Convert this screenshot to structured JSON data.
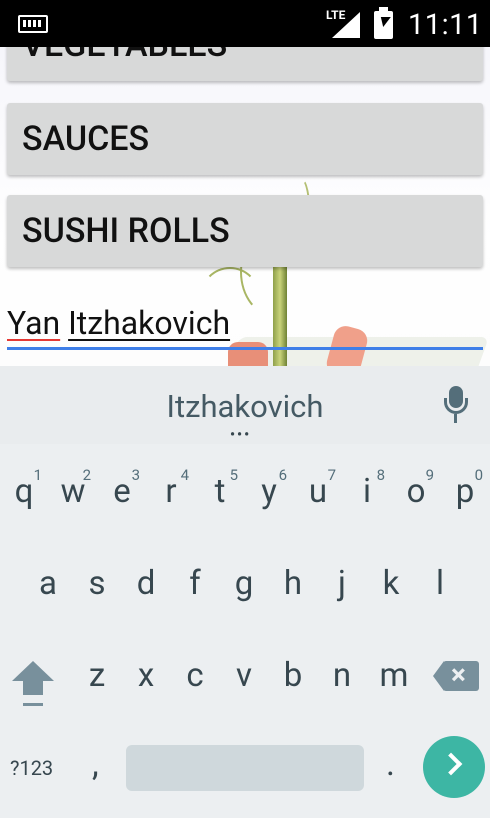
{
  "status_bar": {
    "network_label": "LTE",
    "time": "11:11"
  },
  "app": {
    "categories": [
      "VEGETABLES",
      "SAUCES",
      "SUSHI ROLLS"
    ],
    "input": {
      "word1": "Yan",
      "word2": "Itzhakovich"
    }
  },
  "keyboard": {
    "suggestion": "Itzhakovich",
    "suggestion_more": "•••",
    "row1": [
      {
        "key": "q",
        "num": "1"
      },
      {
        "key": "w",
        "num": "2"
      },
      {
        "key": "e",
        "num": "3"
      },
      {
        "key": "r",
        "num": "4"
      },
      {
        "key": "t",
        "num": "5"
      },
      {
        "key": "y",
        "num": "6"
      },
      {
        "key": "u",
        "num": "7"
      },
      {
        "key": "i",
        "num": "8"
      },
      {
        "key": "o",
        "num": "9"
      },
      {
        "key": "p",
        "num": "0"
      }
    ],
    "row2": [
      "a",
      "s",
      "d",
      "f",
      "g",
      "h",
      "j",
      "k",
      "l"
    ],
    "row3": [
      "z",
      "x",
      "c",
      "v",
      "b",
      "n",
      "m"
    ],
    "symbols_label": "?123",
    "comma": ",",
    "period": "."
  }
}
